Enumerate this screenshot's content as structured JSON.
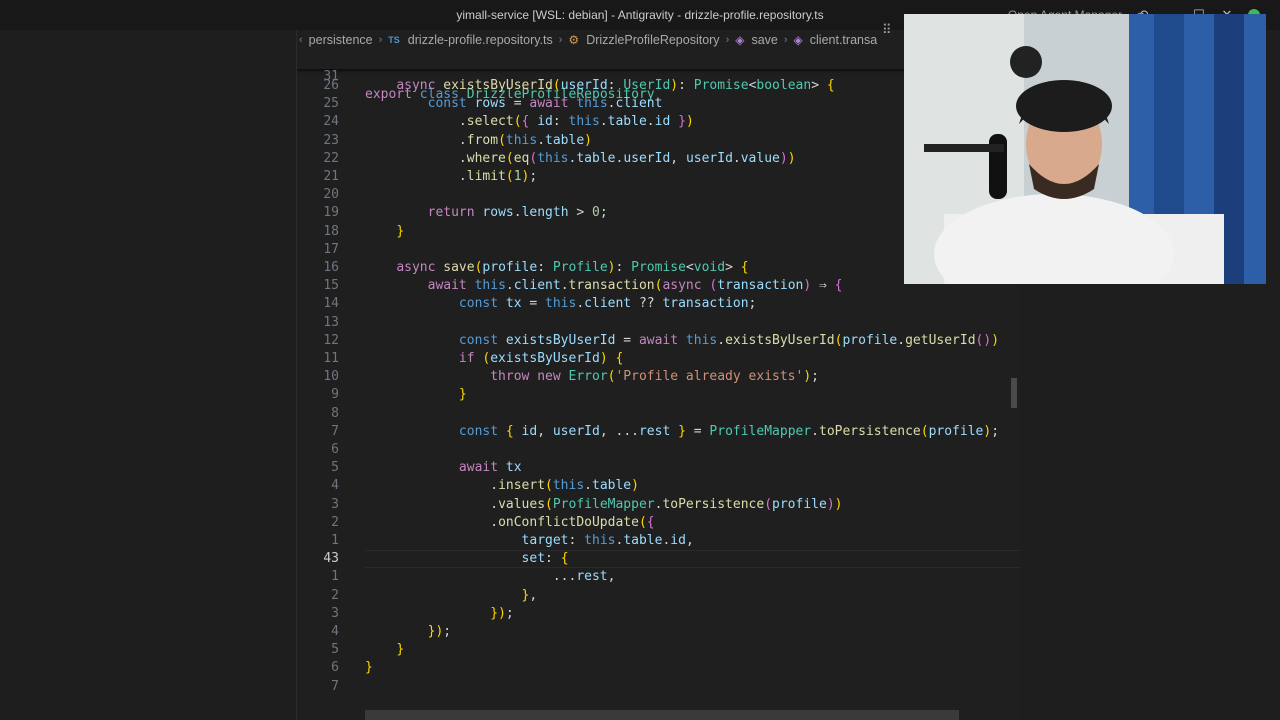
{
  "window": {
    "title": "yimall-service [WSL: debian] - Antigravity - drizzle-profile.repository.ts",
    "manager_label": "Open Agent Manager"
  },
  "breadcrumb": {
    "items": [
      "persistence",
      "drizzle-profile.repository.ts",
      "DrizzleProfileRepository",
      "save",
      "client.transa"
    ],
    "ts_badge": "TS"
  },
  "sticky": {
    "line_number": "31",
    "code": "export class DrizzleProfileRepository"
  },
  "active_line_number": "43",
  "lines": [
    {
      "n": "26",
      "code": "    async existsByUserId(userId: UserId): Promise<boolean> {"
    },
    {
      "n": "25",
      "code": "        const rows = await this.client"
    },
    {
      "n": "24",
      "code": "            .select({ id: this.table.id })"
    },
    {
      "n": "23",
      "code": "            .from(this.table)"
    },
    {
      "n": "22",
      "code": "            .where(eq(this.table.userId, userId.value))"
    },
    {
      "n": "21",
      "code": "            .limit(1);"
    },
    {
      "n": "20",
      "code": ""
    },
    {
      "n": "19",
      "code": "        return rows.length > 0;"
    },
    {
      "n": "18",
      "code": "    }"
    },
    {
      "n": "17",
      "code": ""
    },
    {
      "n": "16",
      "code": "    async save(profile: Profile): Promise<void> {"
    },
    {
      "n": "15",
      "code": "        await this.client.transaction(async (transaction) ⇒ {"
    },
    {
      "n": "14",
      "code": "            const tx = this.client ?? transaction;"
    },
    {
      "n": "13",
      "code": ""
    },
    {
      "n": "12",
      "code": "            const existsByUserId = await this.existsByUserId(profile.getUserId())"
    },
    {
      "n": "11",
      "code": "            if (existsByUserId) {"
    },
    {
      "n": "10",
      "code": "                throw new Error('Profile already exists');"
    },
    {
      "n": "9",
      "code": "            }"
    },
    {
      "n": "8",
      "code": ""
    },
    {
      "n": "7",
      "code": "            const { id, userId, ...rest } = ProfileMapper.toPersistence(profile);"
    },
    {
      "n": "6",
      "code": ""
    },
    {
      "n": "5",
      "code": "            await tx"
    },
    {
      "n": "4",
      "code": "                .insert(this.table)"
    },
    {
      "n": "3",
      "code": "                .values(ProfileMapper.toPersistence(profile))"
    },
    {
      "n": "2",
      "code": "                .onConflictDoUpdate({"
    },
    {
      "n": "1",
      "code": "                    target: this.table.id,"
    },
    {
      "n": "43",
      "code": "                    set: {"
    },
    {
      "n": "1",
      "code": "                        ...rest,"
    },
    {
      "n": "2",
      "code": "                    },"
    },
    {
      "n": "3",
      "code": "                });"
    },
    {
      "n": "4",
      "code": "        });"
    },
    {
      "n": "5",
      "code": "    }"
    },
    {
      "n": "6",
      "code": "}"
    },
    {
      "n": "7",
      "code": ""
    }
  ],
  "colors": {
    "keyword": "#c586c0",
    "storage": "#569cd6",
    "type": "#4ec9b0",
    "function": "#dcdcaa",
    "variable": "#9cdcfe",
    "string": "#ce9178",
    "number": "#b5cea8"
  }
}
